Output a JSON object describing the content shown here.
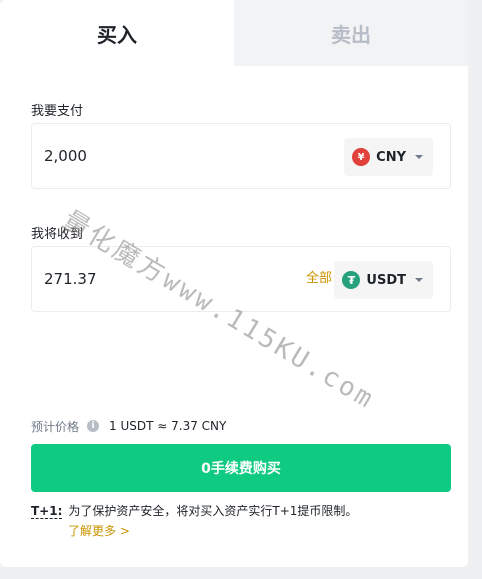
{
  "tabs": [
    {
      "label": "买入",
      "active": true
    },
    {
      "label": "卖出",
      "active": false
    }
  ],
  "pay": {
    "label": "我要支付",
    "value": "2,000",
    "currency": "CNY",
    "currency_icon": "yuan-coin-icon",
    "icon_glyph": "¥"
  },
  "receive": {
    "label": "我将收到",
    "value": "271.37",
    "all_label": "全部",
    "currency": "USDT",
    "currency_icon": "tether-coin-icon",
    "icon_glyph": "₮"
  },
  "price": {
    "label": "预计价格",
    "info_glyph": "i",
    "value": "1 USDT ≈ 7.37 CNY"
  },
  "buy_button": {
    "label": "0手续费购买"
  },
  "note": {
    "tag": "T+1:",
    "text": "为了保护资产安全，将对买入资产实行T+1提币限制。",
    "learn_more": "了解更多 >"
  },
  "watermark": "量化魔方www.115KU.com",
  "colors": {
    "accent_green": "#0ecb81",
    "accent_gold": "#c99400",
    "cny_red": "#e2403a",
    "usdt_green": "#26a17b"
  }
}
